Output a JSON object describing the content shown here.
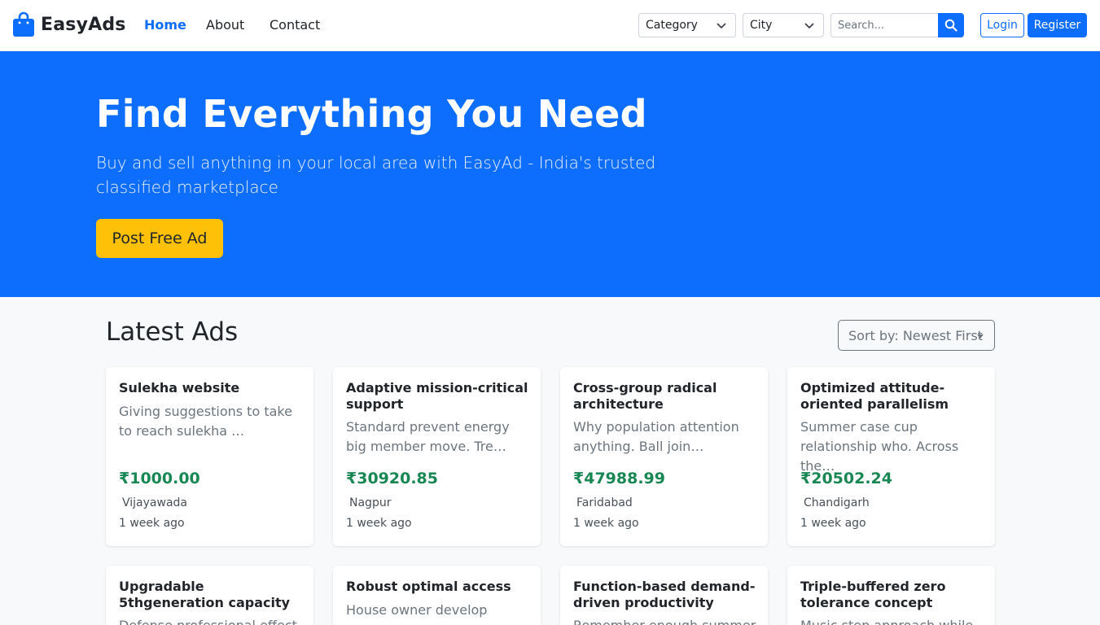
{
  "brand": {
    "name": "EasyAds"
  },
  "nav": {
    "home": "Home",
    "about": "About",
    "contact": "Contact"
  },
  "filters": {
    "category": "Category",
    "city": "City",
    "search_placeholder": "Search..."
  },
  "auth": {
    "login": "Login",
    "register": "Register"
  },
  "hero": {
    "title": "Find Everything You Need",
    "subtitle": "Buy and sell anything in your local area with EasyAd - India's trusted classified marketplace",
    "cta": "Post Free Ad"
  },
  "latest": {
    "title": "Latest Ads",
    "sort": "Sort by: Newest First",
    "ads": [
      {
        "title": "Sulekha website",
        "desc": "Giving suggestions to take to reach sulekha …",
        "price": "₹1000.00",
        "city": "Vijayawada",
        "time": "1 week ago"
      },
      {
        "title": "Adaptive mission-critical support",
        "desc": "Standard prevent energy big member move. Tre…",
        "price": "₹30920.85",
        "city": "Nagpur",
        "time": "1 week ago"
      },
      {
        "title": "Cross-group radical architecture",
        "desc": "Why population attention anything. Ball join…",
        "price": "₹47988.99",
        "city": "Faridabad",
        "time": "1 week ago"
      },
      {
        "title": "Optimized attitude-oriented parallelism",
        "desc": "Summer case cup relationship who. Across the…",
        "price": "₹20502.24",
        "city": "Chandigarh",
        "time": "1 week ago"
      },
      {
        "title": "Upgradable 5thgeneration capacity",
        "desc": "Defense professional effect",
        "price": "",
        "city": "",
        "time": ""
      },
      {
        "title": "Robust optimal access",
        "desc": "House owner develop",
        "price": "",
        "city": "",
        "time": ""
      },
      {
        "title": "Function-based demand-driven productivity",
        "desc": "Remember enough summer",
        "price": "",
        "city": "",
        "time": ""
      },
      {
        "title": "Triple-buffered zero tolerance concept",
        "desc": "Music step approach while",
        "price": "",
        "city": "",
        "time": ""
      }
    ]
  }
}
